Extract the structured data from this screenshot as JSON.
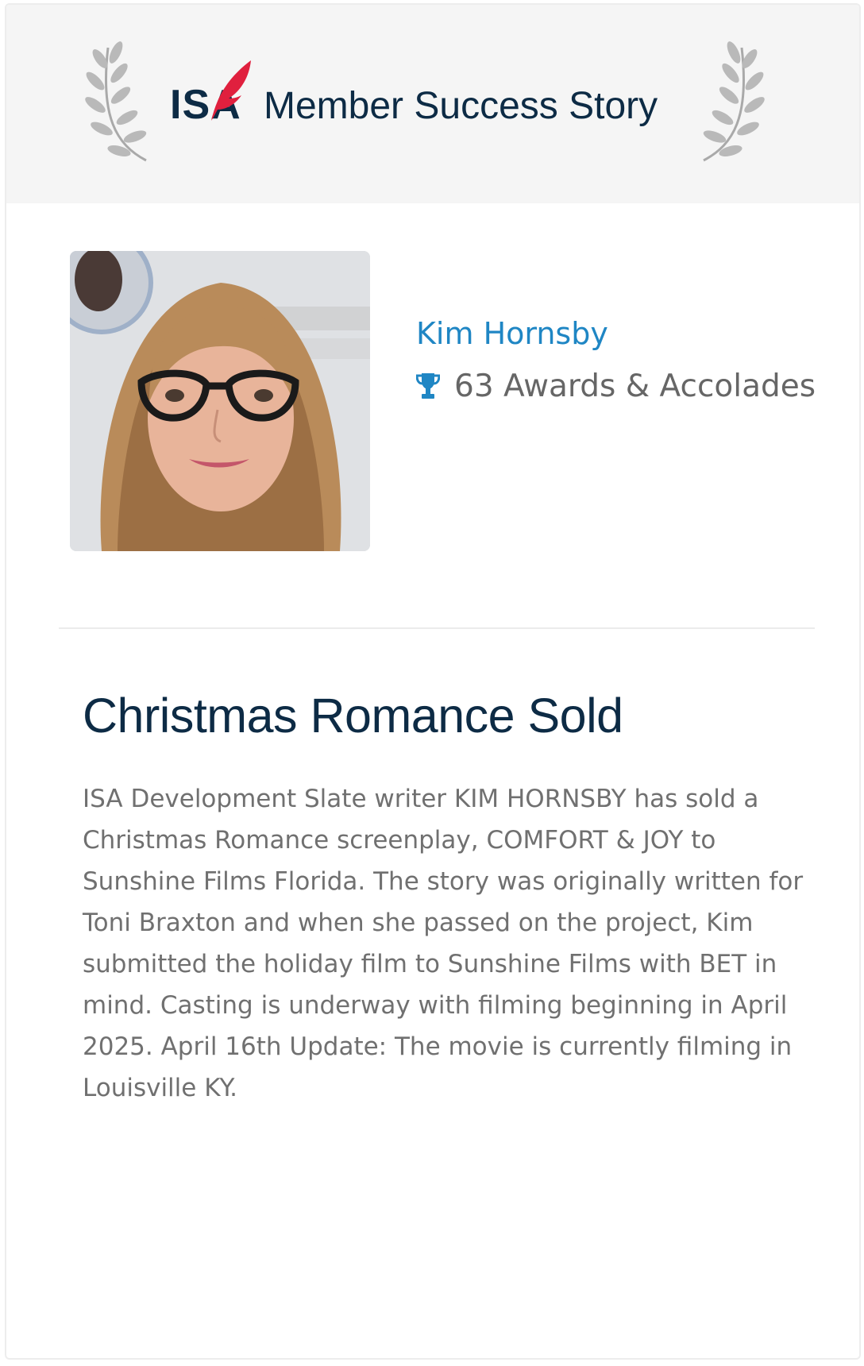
{
  "header": {
    "brand_mark": "ISA",
    "title": "Member Success Story",
    "laurel_icon": "laurel-wreath-icon",
    "quill_icon": "quill-feather-icon",
    "colors": {
      "background": "#f5f5f5",
      "navy": "#0d2b45",
      "quill_red": "#e0203e",
      "laurel": "#b7b7b7"
    }
  },
  "member": {
    "name": "Kim Hornsby",
    "awards": "63 Awards & Accolades",
    "awards_icon": "trophy-icon",
    "name_color": "#1f86c4"
  },
  "story": {
    "title": "Christmas Romance Sold",
    "body": "ISA Development Slate writer KIM HORNSBY has sold a Christmas Romance screenplay, COMFORT & JOY to Sunshine Films Florida. The story was originally written for Toni Braxton and when she passed on the project, Kim submitted the holiday film to Sunshine Films with BET in mind. Casting is underway with filming beginning in April 2025. April 16th Update: The movie is currently filming in Louisville KY."
  }
}
